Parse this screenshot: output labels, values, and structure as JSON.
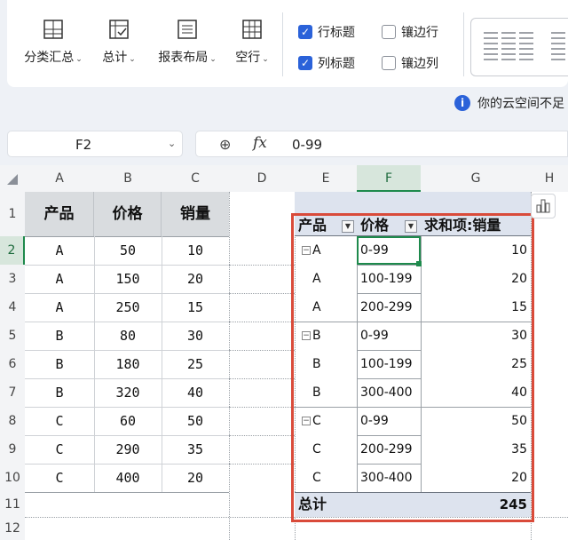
{
  "ribbon": {
    "buttons": [
      {
        "label": "分类汇总",
        "icon": "subtotal-icon"
      },
      {
        "label": "总计",
        "icon": "grand-total-icon"
      },
      {
        "label": "报表布局",
        "icon": "report-layout-icon"
      },
      {
        "label": "空行",
        "icon": "blank-rows-icon"
      }
    ],
    "checkboxes": [
      {
        "label": "行标题",
        "checked": true
      },
      {
        "label": "镶边行",
        "checked": false
      },
      {
        "label": "列标题",
        "checked": true
      },
      {
        "label": "镶边列",
        "checked": false
      }
    ]
  },
  "info": {
    "text": "你的云空间不足"
  },
  "formula_bar": {
    "name_box": "F2",
    "fx": "fx",
    "value": "0-99"
  },
  "columns": [
    "A",
    "B",
    "C",
    "D",
    "E",
    "F",
    "G",
    "H"
  ],
  "rows": [
    "1",
    "2",
    "3",
    "4",
    "5",
    "6",
    "7",
    "8",
    "9",
    "10",
    "11",
    "12"
  ],
  "source_table": {
    "headers": [
      "产品",
      "价格",
      "销量"
    ],
    "rows": [
      [
        "A",
        "50",
        "10"
      ],
      [
        "A",
        "150",
        "20"
      ],
      [
        "A",
        "250",
        "15"
      ],
      [
        "B",
        "80",
        "30"
      ],
      [
        "B",
        "180",
        "25"
      ],
      [
        "B",
        "320",
        "40"
      ],
      [
        "C",
        "60",
        "50"
      ],
      [
        "C",
        "290",
        "35"
      ],
      [
        "C",
        "400",
        "20"
      ]
    ]
  },
  "pivot": {
    "headers": [
      "产品",
      "价格",
      "求和项:销量"
    ],
    "rows": [
      {
        "product": "A",
        "group": true,
        "price": "0-99",
        "sales": "10"
      },
      {
        "product": "A",
        "group": false,
        "price": "100-199",
        "sales": "20"
      },
      {
        "product": "A",
        "group": false,
        "price": "200-299",
        "sales": "15"
      },
      {
        "product": "B",
        "group": true,
        "price": "0-99",
        "sales": "30"
      },
      {
        "product": "B",
        "group": false,
        "price": "100-199",
        "sales": "25"
      },
      {
        "product": "B",
        "group": false,
        "price": "300-400",
        "sales": "40"
      },
      {
        "product": "C",
        "group": true,
        "price": "0-99",
        "sales": "50"
      },
      {
        "product": "C",
        "group": false,
        "price": "200-299",
        "sales": "35"
      },
      {
        "product": "C",
        "group": false,
        "price": "300-400",
        "sales": "20"
      }
    ],
    "total_label": "总计",
    "total_value": "245"
  },
  "colors": {
    "accent": "#2b62d9",
    "selection": "#1e8a4c",
    "highlight_box": "#d94b3a",
    "pivot_header": "#dde3ee"
  }
}
